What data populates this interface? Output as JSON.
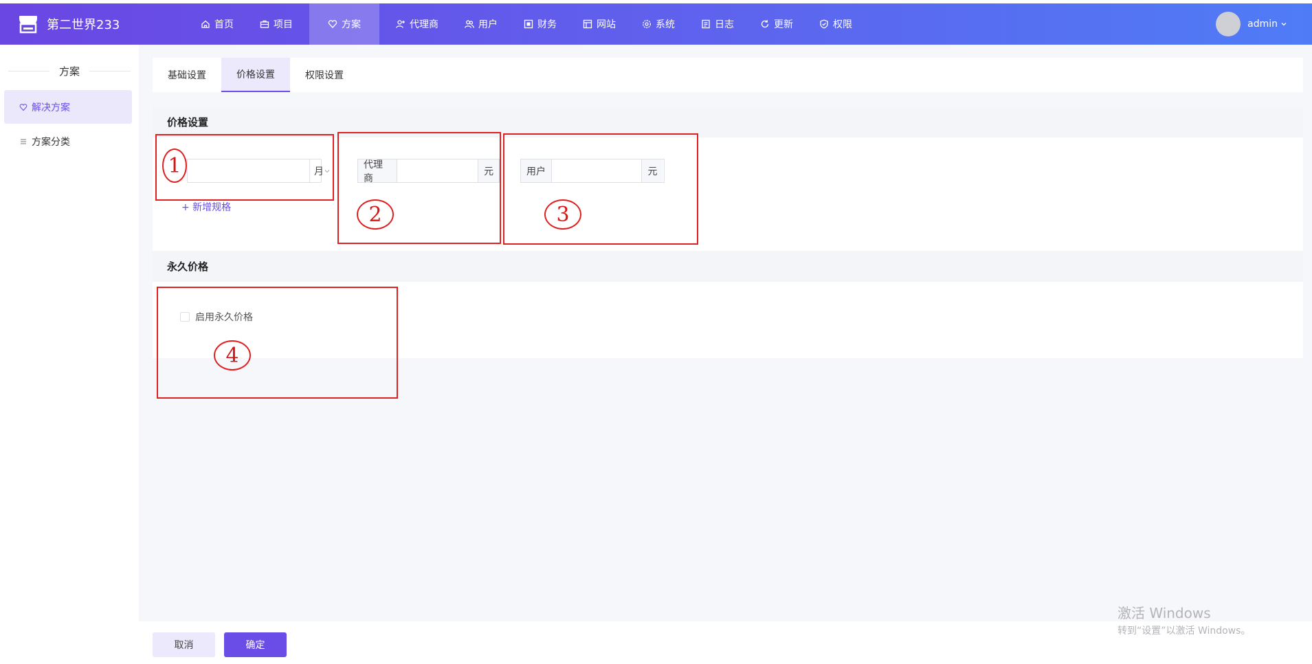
{
  "header": {
    "brand": "第二世界233",
    "nav": [
      {
        "label": "首页",
        "icon": "home-icon"
      },
      {
        "label": "项目",
        "icon": "briefcase-icon"
      },
      {
        "label": "方案",
        "icon": "heart-icon",
        "active": true
      },
      {
        "label": "代理商",
        "icon": "user-plus-icon"
      },
      {
        "label": "用户",
        "icon": "users-icon"
      },
      {
        "label": "财务",
        "icon": "finance-icon"
      },
      {
        "label": "网站",
        "icon": "layout-icon"
      },
      {
        "label": "系统",
        "icon": "gear-icon"
      },
      {
        "label": "日志",
        "icon": "document-icon"
      },
      {
        "label": "更新",
        "icon": "refresh-icon"
      },
      {
        "label": "权限",
        "icon": "shield-check-icon"
      }
    ],
    "user": "admin"
  },
  "sidebar": {
    "title": "方案",
    "items": [
      {
        "label": "解决方案",
        "icon": "heart-icon",
        "active": true
      },
      {
        "label": "方案分类",
        "icon": "list-icon"
      }
    ]
  },
  "tabs": [
    {
      "label": "基础设置"
    },
    {
      "label": "价格设置",
      "active": true
    },
    {
      "label": "权限设置"
    }
  ],
  "price_section": {
    "title": "价格设置",
    "period_unit": "月",
    "period_value": "",
    "agent_label": "代理商",
    "agent_value": "",
    "agent_unit": "元",
    "user_label": "用户",
    "user_value": "",
    "user_unit": "元",
    "add_spec": "+ 新增规格"
  },
  "permanent_section": {
    "title": "永久价格",
    "checkbox_label": "启用永久价格",
    "checked": false
  },
  "footer": {
    "cancel": "取消",
    "confirm": "确定"
  },
  "annotations": [
    "1",
    "2",
    "3",
    "4"
  ],
  "watermark": {
    "title": "激活 Windows",
    "subtitle": "转到“设置”以激活 Windows。"
  },
  "colors": {
    "accent": "#6a4de6",
    "header_start": "#6a46e3",
    "header_end": "#4f7cf6",
    "annotation": "#e01f1f"
  }
}
